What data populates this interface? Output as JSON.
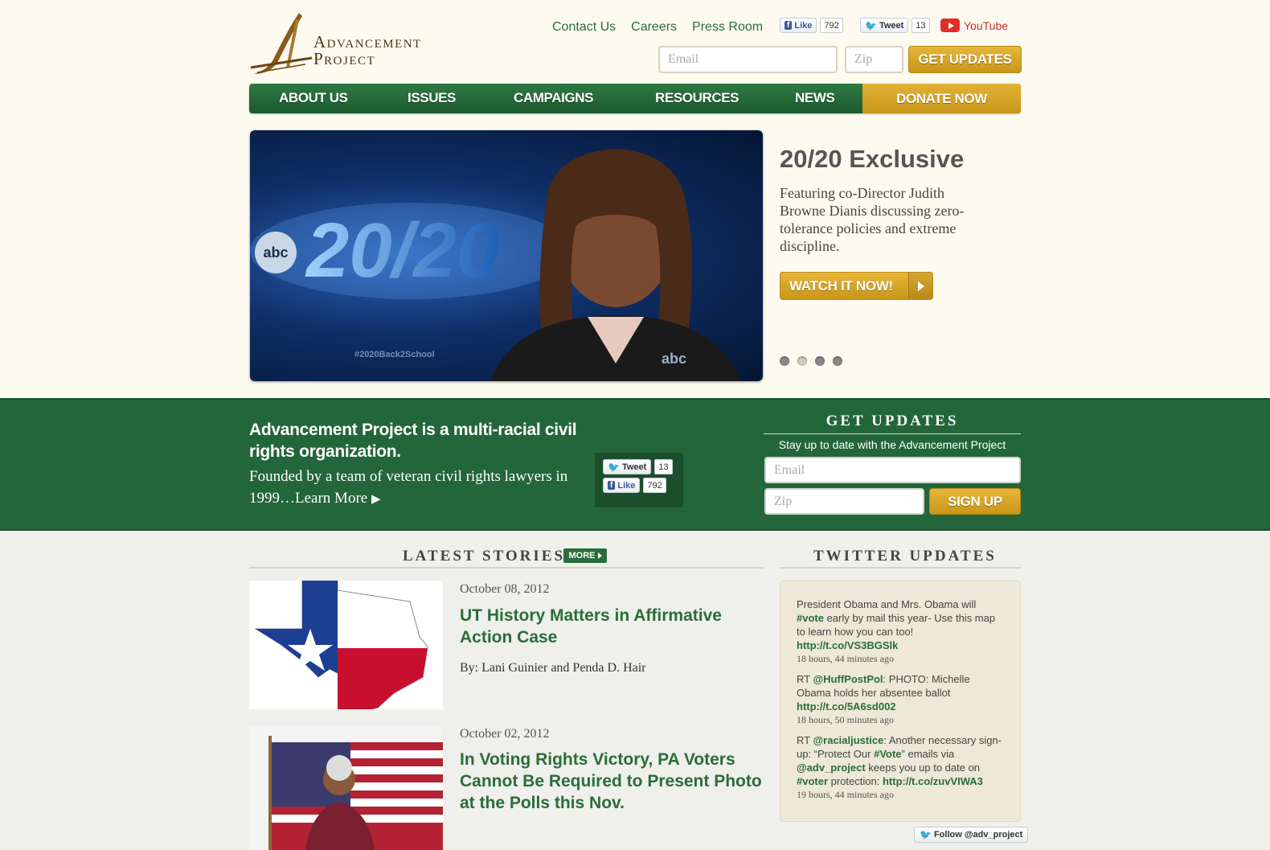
{
  "brand": {
    "line1": "Advancement",
    "line2": "Project"
  },
  "top_links": [
    "Contact Us",
    "Careers",
    "Press Room"
  ],
  "social": {
    "like_label": "Like",
    "like_count": "792",
    "tweet_label": "Tweet",
    "tweet_count": "13",
    "youtube_label": "YouTube"
  },
  "header_signup": {
    "email_placeholder": "Email",
    "zip_placeholder": "Zip",
    "button": "Get Updates"
  },
  "nav": {
    "items": [
      "About Us",
      "Issues",
      "Campaigns",
      "Resources",
      "News"
    ],
    "donate": "Donate Now"
  },
  "hero": {
    "image_caption": "#2020Back2School",
    "image_logo": "abc",
    "image_show": "20/20",
    "title": "20/20 Exclusive",
    "description": "Featuring co-Director Judith Browne Dianis discussing zero-tolerance policies and extreme discipline.",
    "button": "Watch It Now!",
    "slides": 4,
    "active_slide": 2
  },
  "about": {
    "headline": "Advancement Project is a multi-racial civil rights organization.",
    "text": "Founded by a team of veteran civil rights lawyers in 1999…",
    "learn_more": "Learn More"
  },
  "get_updates": {
    "title": "Get Updates",
    "subtitle": "Stay up to date with the Advancement Project",
    "email_placeholder": "Email",
    "zip_placeholder": "Zip",
    "button": "Sign Up"
  },
  "latest_stories": {
    "title": "Latest Stories",
    "more": "MORE",
    "items": [
      {
        "date": "October 08, 2012",
        "title": "UT History Matters in Affirmative Action Case",
        "byline": "By: Lani Guinier and Penda D. Hair"
      },
      {
        "date": "October 02, 2012",
        "title": "In Voting Rights Victory, PA Voters Cannot Be Required to Present Photo at the Polls this Nov.",
        "byline": ""
      }
    ]
  },
  "twitter": {
    "title": "Twitter Updates",
    "tweets": [
      {
        "pre": "President Obama and Mrs. Obama will ",
        "tag": "#vote",
        "post": " early by mail this year- Use this map to learn how you can too! ",
        "link": "http://t.co/VS3BGSlk",
        "time": "18 hours, 44 minutes ago"
      },
      {
        "pre": "RT ",
        "tag": "@HuffPostPol",
        "post": ": PHOTO: Michelle Obama holds her absentee ballot ",
        "link": "http://t.co/5A6sd002",
        "time": "18 hours, 50 minutes ago"
      },
      {
        "pre": "RT ",
        "tag": "@racialjustice",
        "post": ": Another necessary sign-up: “Protect Our ",
        "tag2": "#Vote",
        "post2": "” emails via ",
        "tag3": "@adv_project",
        "post3": " keeps you up to date on ",
        "tag4": "#voter",
        "post4": " protection: ",
        "link": "http://t.co/zuvVIWA3",
        "time": "19 hours, 44 minutes ago"
      }
    ],
    "follow": "Follow @adv_project"
  },
  "colors": {
    "green": "#23663a",
    "gold": "#d6a52a",
    "cream": "#fdfaef"
  }
}
